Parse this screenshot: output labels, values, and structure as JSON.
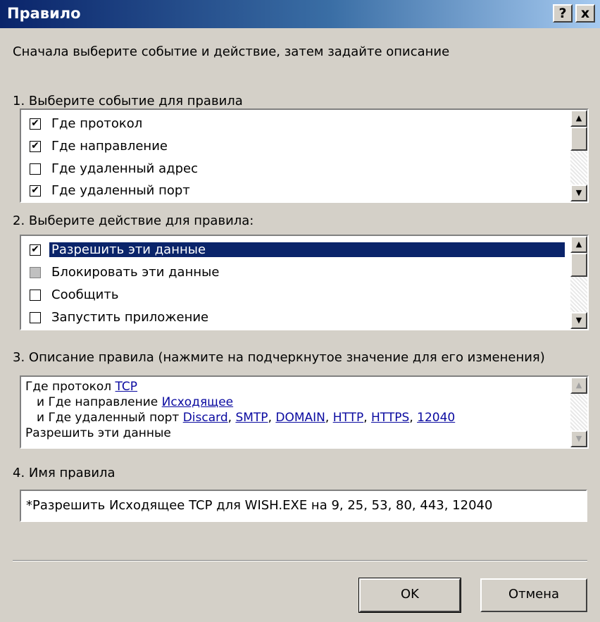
{
  "window": {
    "title": "Правило",
    "help_button": "?",
    "close_button": "x"
  },
  "instruction": "Сначала выберите событие и действие, затем задайте описание",
  "section_events": {
    "label": "1. Выберите событие для правила",
    "items": [
      {
        "label": "Где протокол",
        "mark": "✔"
      },
      {
        "label": "Где направление",
        "mark": "✔"
      },
      {
        "label": "Где удаленный адрес",
        "mark": ""
      },
      {
        "label": "Где удаленный порт",
        "mark": "✔"
      }
    ]
  },
  "section_actions": {
    "label": "2. Выберите действие для правила:",
    "items": [
      {
        "label": "Разрешить эти данные",
        "mark": "✔",
        "selected": true
      },
      {
        "label": "Блокировать эти данные",
        "mark": "",
        "dimmed": true
      },
      {
        "label": "Сообщить",
        "mark": ""
      },
      {
        "label": "Запустить приложение",
        "mark": ""
      }
    ]
  },
  "section_description": {
    "label": "3. Описание правила (нажмите на подчеркнутое значение для его изменения)",
    "line1_prefix": "Где протокол ",
    "line1_link": "TCP",
    "line2_prefix": "и Где направление ",
    "line2_link": "Исходящее",
    "line3_prefix": "и Где удаленный порт ",
    "ports": [
      "Discard",
      "SMTP",
      "DOMAIN",
      "HTTP",
      "HTTPS",
      "12040"
    ],
    "port_separator": ",",
    "line4": "Разрешить эти данные"
  },
  "section_name": {
    "label": "4. Имя правила",
    "value": "*Разрешить Исходящее TCP для WISH.EXE на 9, 25, 53, 80, 443, 12040"
  },
  "buttons": {
    "ok": "OK",
    "cancel": "Отмена"
  },
  "scroll_glyphs": {
    "up": "▲",
    "down": "▼"
  },
  "colors": {
    "title_bar": "#0a246a",
    "selection": "#0a246a",
    "link": "#0a0aa0",
    "face": "#d4d0c8"
  }
}
